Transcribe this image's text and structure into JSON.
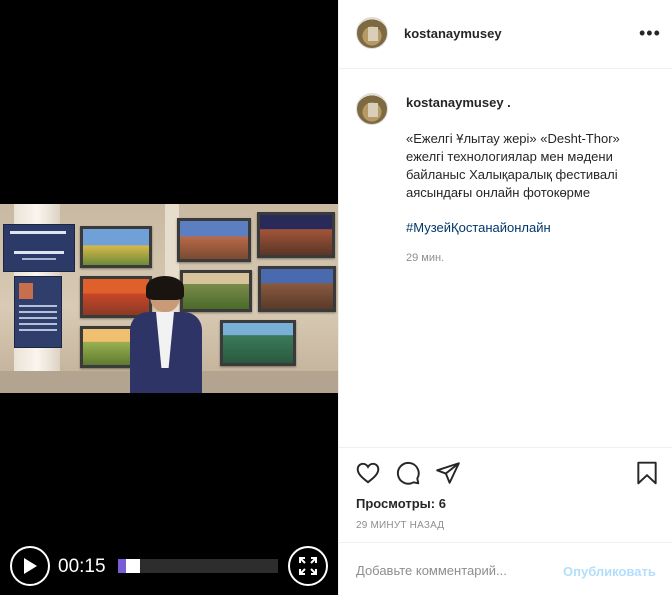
{
  "video": {
    "time_display": "00:15",
    "progress_fraction": 0.14
  },
  "post": {
    "header_username": "kostanaymusey",
    "caption_username": "kostanaymusey .",
    "caption_line1": "«Ежелгі Ұлытау жері» «Desht-Thor»",
    "caption_line2": "ежелгі технологиялар мен мәдени",
    "caption_line3": "байланыс Халықаралық фестивалі",
    "caption_line4": "аясындағы онлайн фотокөрме",
    "hashtag": "#МузейҚостанайонлайн",
    "caption_age": "29 мин.",
    "views": "Просмотры: 6",
    "posted_ago": "29 МИНУТ НАЗАД"
  },
  "comment": {
    "placeholder": "Добавьте комментарий...",
    "publish_label": "Опубликовать"
  },
  "colors": {
    "link": "#00376b",
    "publish_disabled": "#b2dffc",
    "video_progress_accent": "#7a5cd6"
  }
}
